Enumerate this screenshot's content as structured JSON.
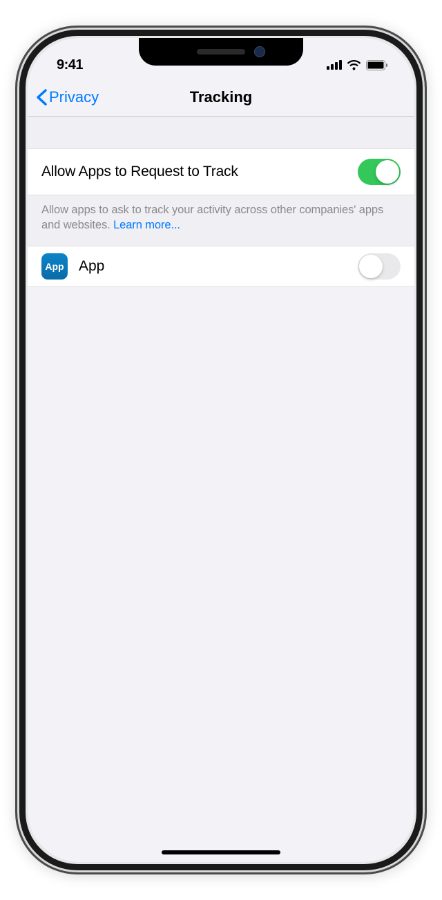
{
  "status": {
    "time": "9:41"
  },
  "nav": {
    "back_label": "Privacy",
    "title": "Tracking"
  },
  "main_toggle": {
    "label": "Allow Apps to Request to Track",
    "on": true
  },
  "footer": {
    "text": "Allow apps to ask to track your activity across other companies' apps and websites. ",
    "link": "Learn more..."
  },
  "apps": [
    {
      "icon_text": "App",
      "name": "App",
      "on": false
    }
  ]
}
